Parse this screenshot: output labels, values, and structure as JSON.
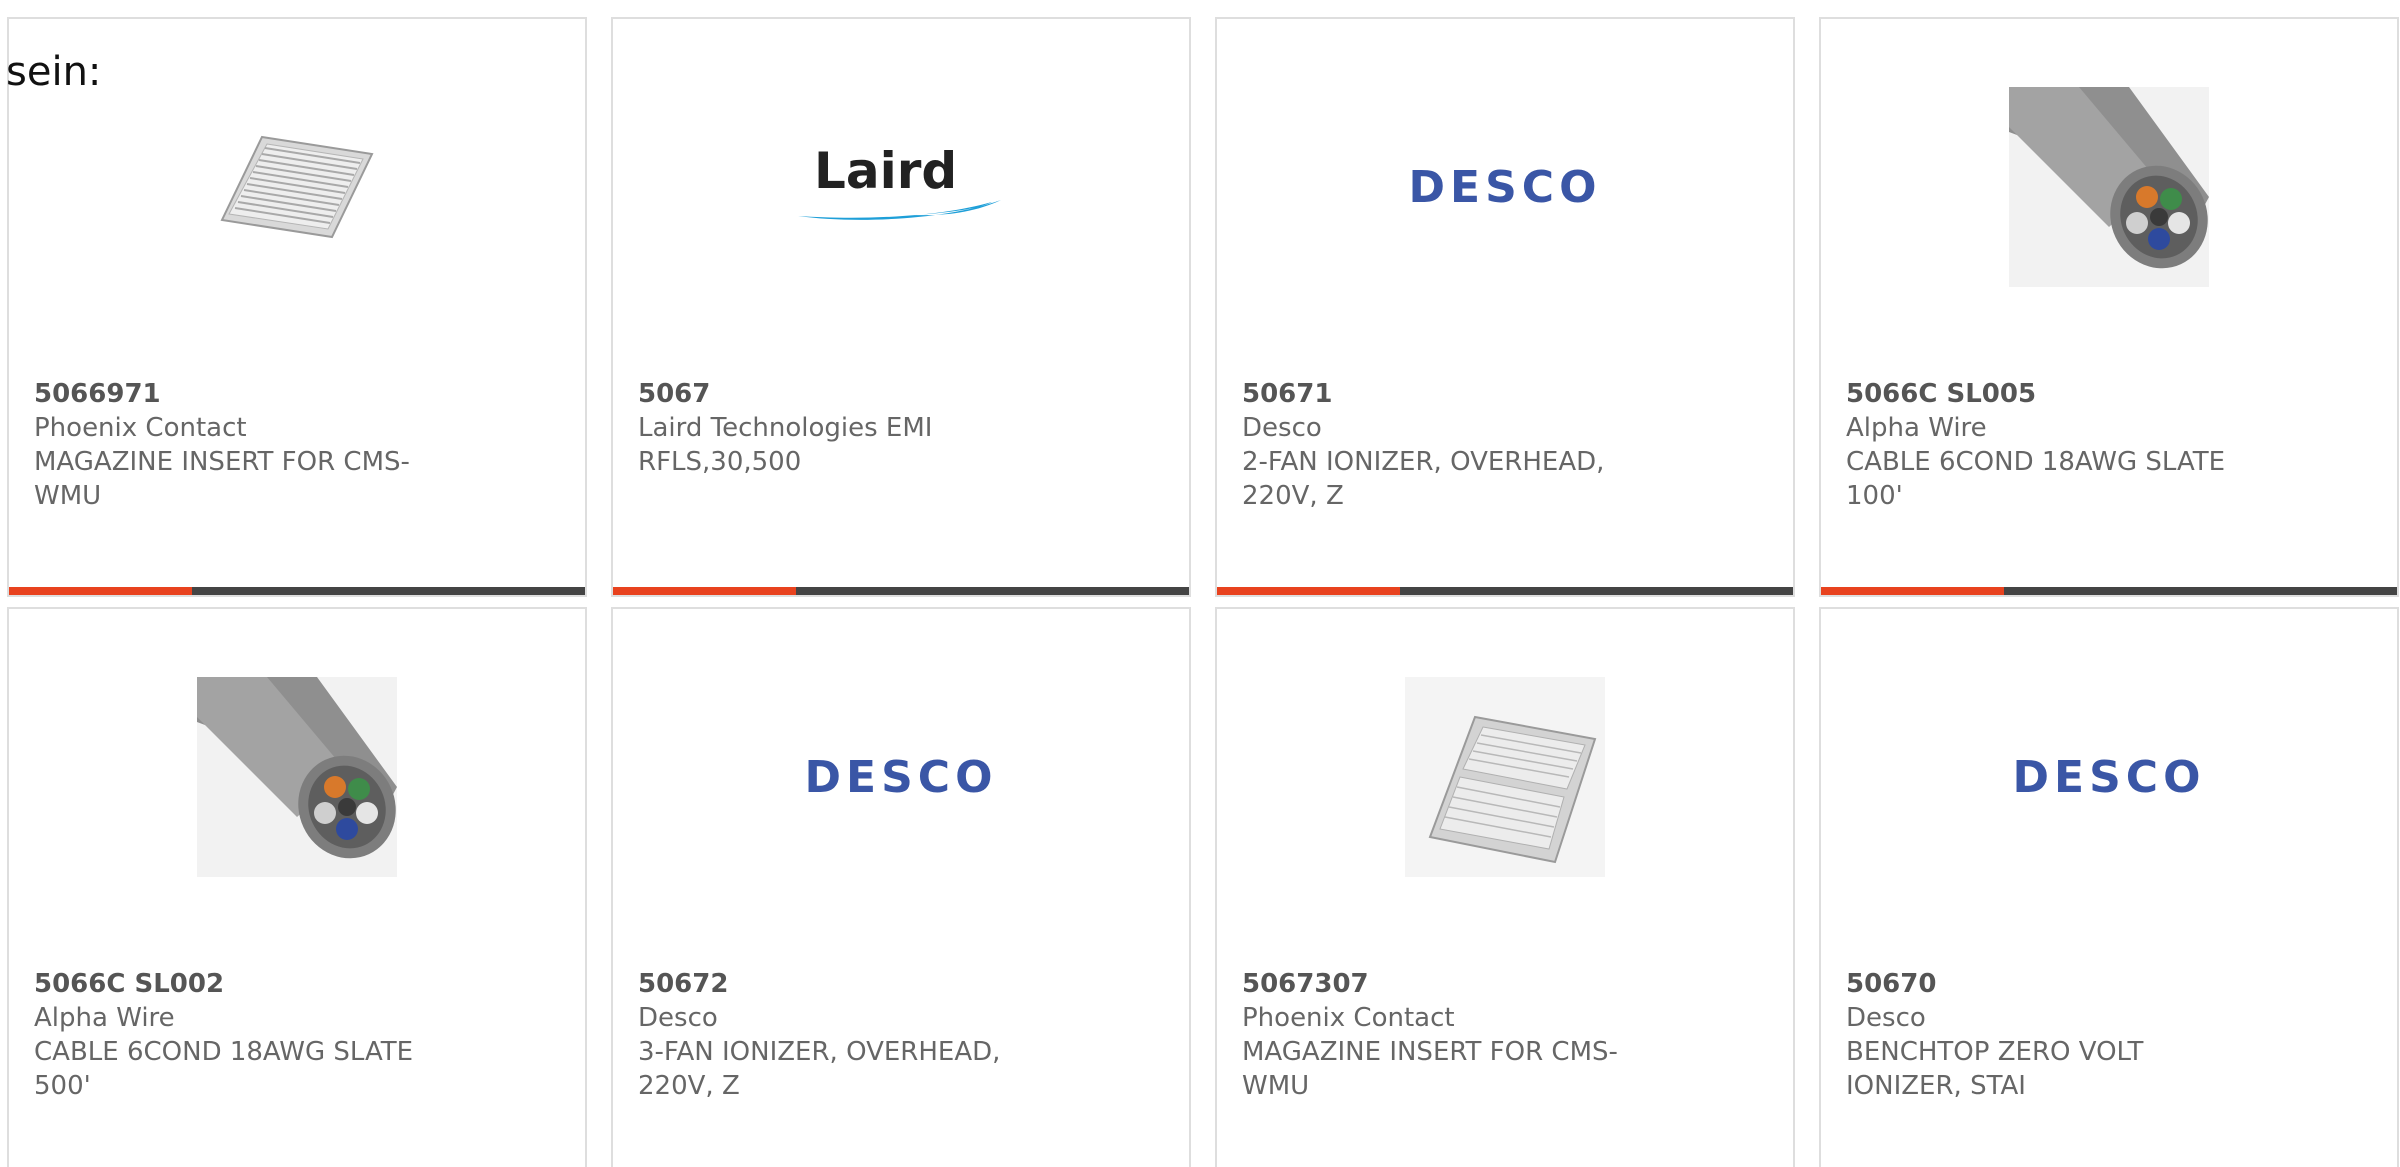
{
  "intro_text": "sein:",
  "colors": {
    "accent_bar": "#e8421e",
    "bar": "#444444",
    "desco_blue": "#3a56a6",
    "laird_swoosh": "#1e9fd8"
  },
  "products": [
    {
      "part_number": "5066971",
      "manufacturer": "Phoenix Contact",
      "description": "MAGAZINE INSERT FOR CMS-WMU",
      "image": "magazine-insert-tray"
    },
    {
      "part_number": "5067",
      "manufacturer": "Laird Technologies EMI",
      "description": "RFLS,30,500",
      "image": "laird-logo",
      "logo_text": "Laird"
    },
    {
      "part_number": "50671",
      "manufacturer": "Desco",
      "description": "2-FAN IONIZER, OVERHEAD, 220V, Z",
      "image": "desco-logo",
      "logo_text": "DESCO"
    },
    {
      "part_number": "5066C SL005",
      "manufacturer": "Alpha Wire",
      "description": "CABLE 6COND 18AWG SLATE 100'",
      "image": "grey-cable"
    },
    {
      "part_number": "5066C SL002",
      "manufacturer": "Alpha Wire",
      "description": "CABLE 6COND 18AWG SLATE 500'",
      "image": "grey-cable"
    },
    {
      "part_number": "50672",
      "manufacturer": "Desco",
      "description": "3-FAN IONIZER, OVERHEAD, 220V, Z",
      "image": "desco-logo",
      "logo_text": "DESCO"
    },
    {
      "part_number": "5067307",
      "manufacturer": "Phoenix Contact",
      "description": "MAGAZINE INSERT FOR CMS-WMU",
      "image": "magazine-insert-double"
    },
    {
      "part_number": "50670",
      "manufacturer": "Desco",
      "description": "BENCHTOP ZERO VOLT IONIZER, STAI",
      "image": "desco-logo",
      "logo_text": "DESCO"
    }
  ]
}
